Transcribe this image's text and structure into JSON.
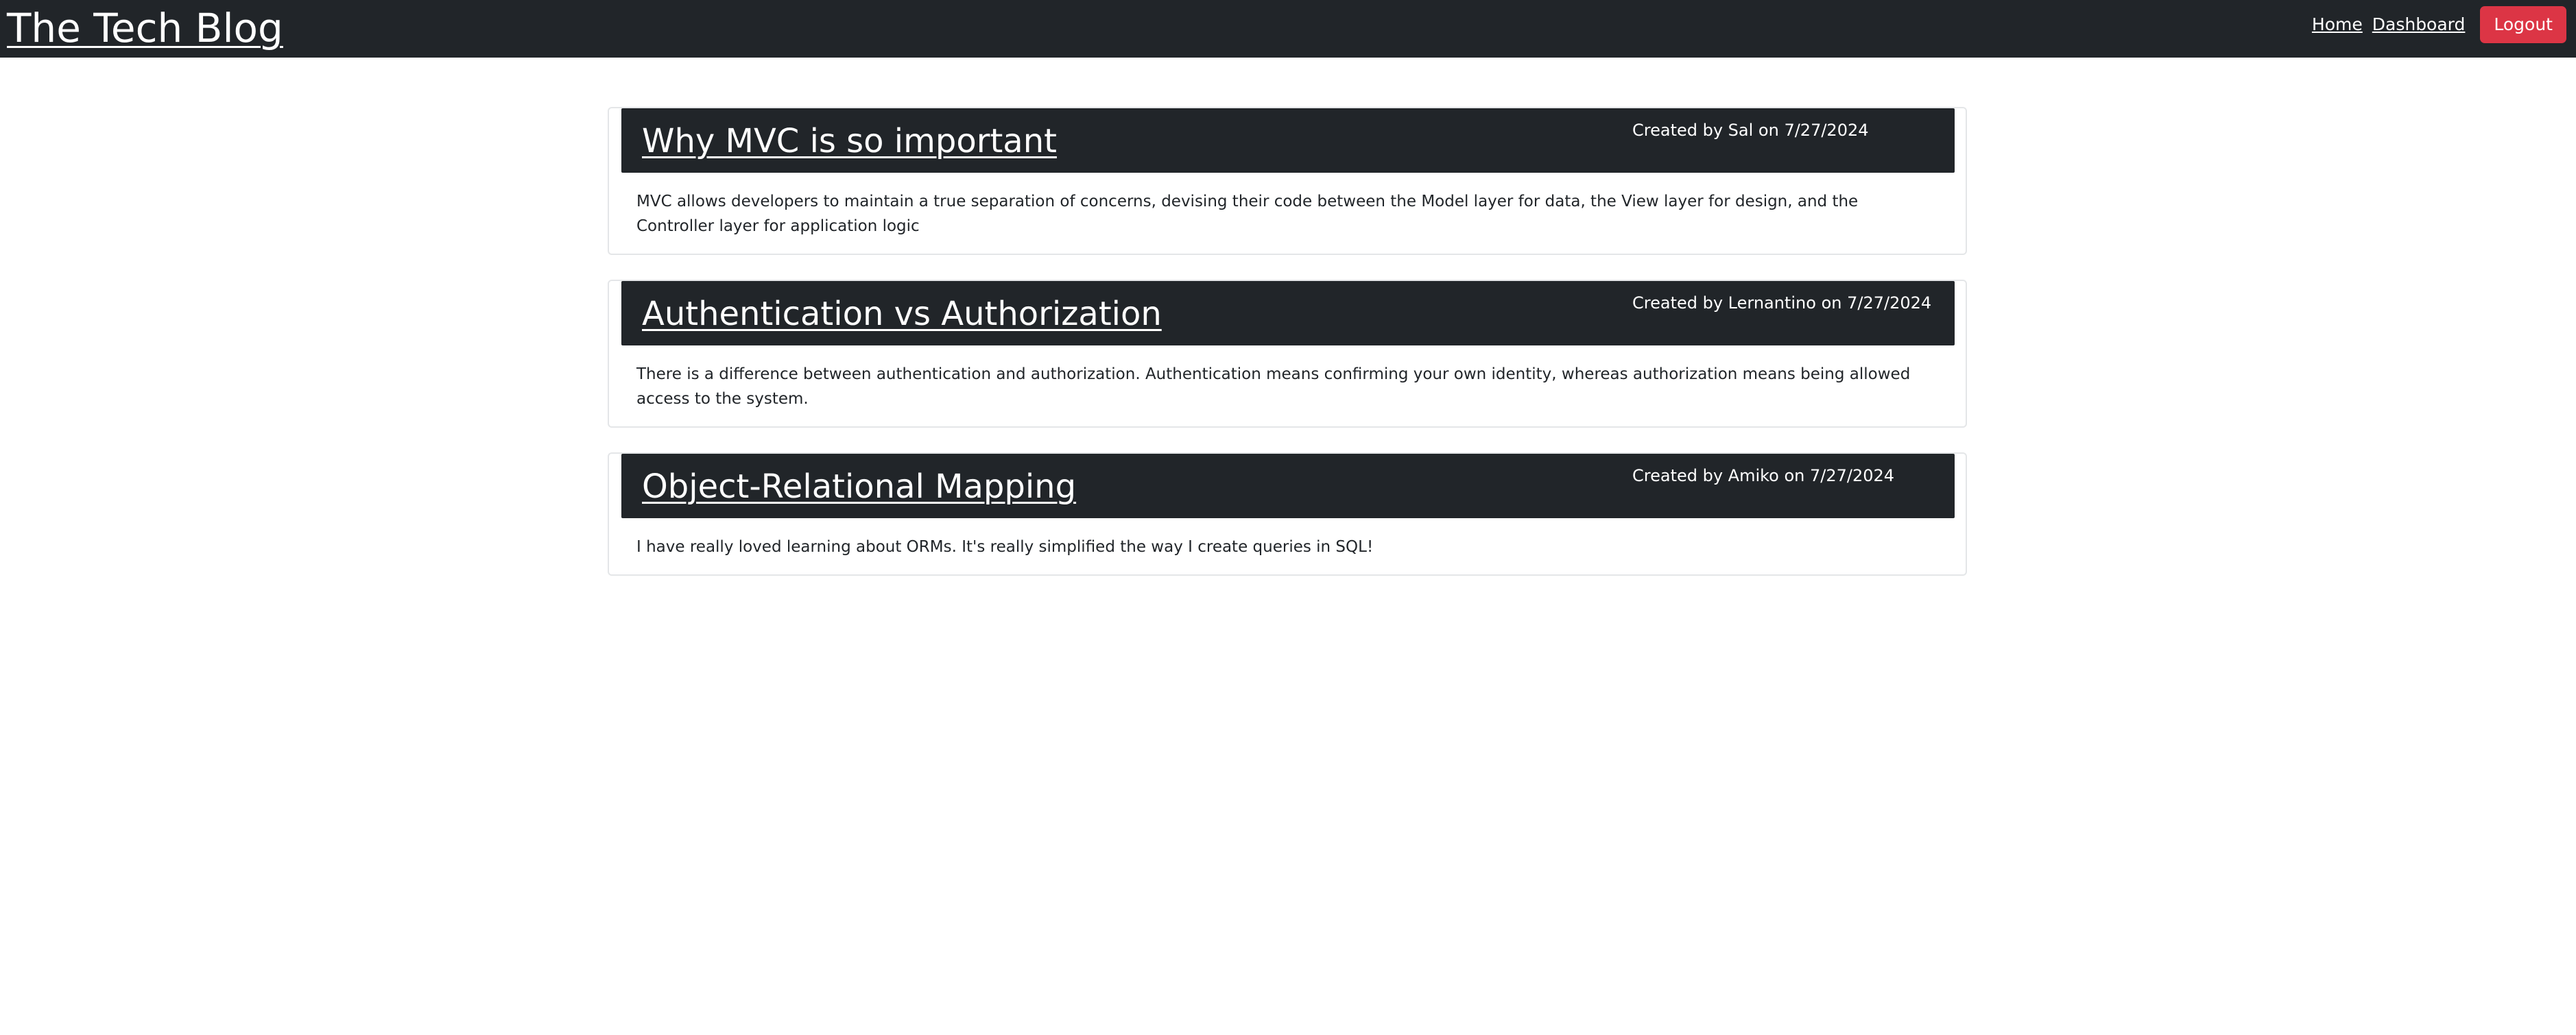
{
  "navbar": {
    "brand": "The Tech Blog",
    "links": [
      {
        "label": "Home"
      },
      {
        "label": "Dashboard"
      }
    ],
    "logout_label": "Logout",
    "colors": {
      "background": "#212529",
      "logout": "#dc3545"
    }
  },
  "posts": [
    {
      "title": "Why MVC is so important",
      "meta": "Created by Sal on 7/27/2024",
      "body": "MVC allows developers to maintain a true separation of concerns, devising their code between the Model layer for data, the View layer for design, and the Controller layer for application logic"
    },
    {
      "title": "Authentication vs Authorization",
      "meta": "Created by Lernantino on 7/27/2024",
      "body": "There is a difference between authentication and authorization. Authentication means confirming your own identity, whereas authorization means being allowed access to the system."
    },
    {
      "title": "Object-Relational Mapping",
      "meta": "Created by Amiko on 7/27/2024",
      "body": "I have really loved learning about ORMs. It's really simplified the way I create queries in SQL!"
    }
  ]
}
